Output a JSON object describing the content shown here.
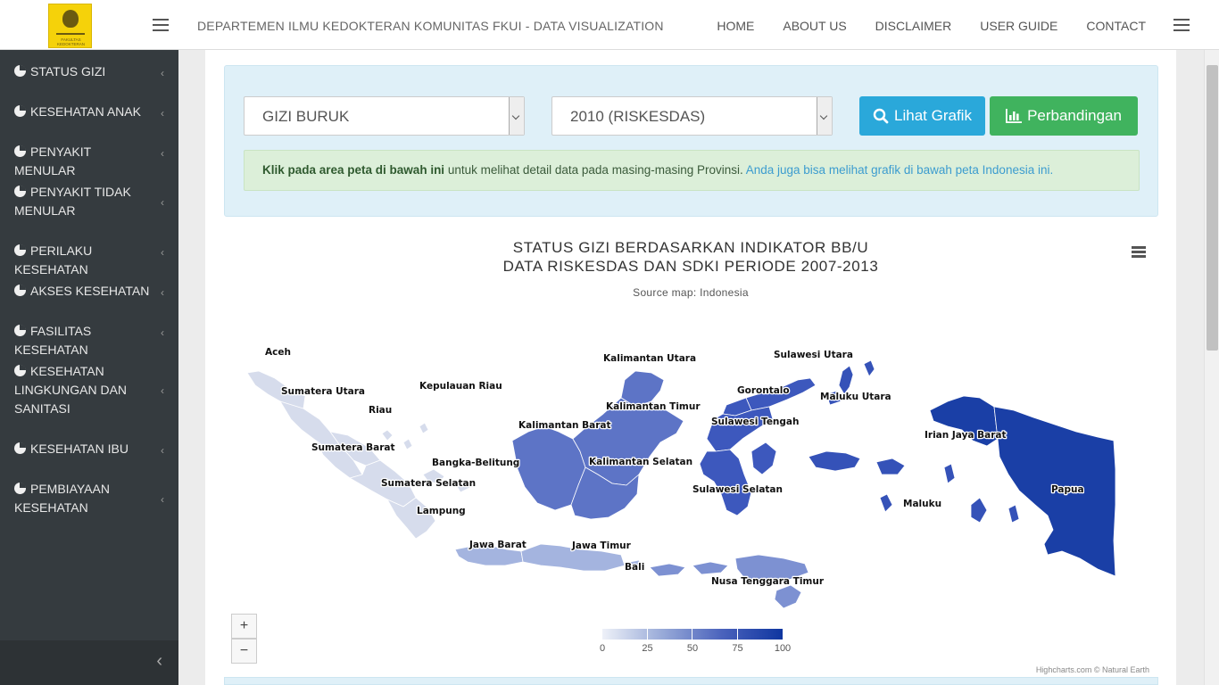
{
  "navbar": {
    "title": "DEPARTEMEN ILMU KEDOKTERAN KOMUNITAS FKUI - DATA VISUALIZATION",
    "menu": [
      "HOME",
      "ABOUT US",
      "DISCLAIMER",
      "USER GUIDE",
      "CONTACT"
    ],
    "logo_text": "FAKULTAS KEDOKTERAN"
  },
  "sidebar": {
    "items": [
      {
        "label": "STATUS GIZI"
      },
      {
        "label": "KESEHATAN ANAK"
      },
      {
        "label": "PENYAKIT MENULAR"
      },
      {
        "label": "PENYAKIT TIDAK MENULAR"
      },
      {
        "label": "PERILAKU KESEHATAN"
      },
      {
        "label": "AKSES KESEHATAN"
      },
      {
        "label": "FASILITAS KESEHATAN"
      },
      {
        "label": "KESEHATAN LINGKUNGAN DAN SANITASI"
      },
      {
        "label": "KESEHATAN IBU"
      },
      {
        "label": "PEMBIAYAAN KESEHATAN"
      }
    ]
  },
  "filters": {
    "indicator": "GIZI BURUK",
    "period": "2010 (RISKESDAS)",
    "view_button": "Lihat Grafik",
    "compare_button": "Perbandingan"
  },
  "notice": {
    "bold": "Klik pada area peta di bawah ini",
    "text": " untuk melihat detail data pada masing-masing Provinsi. ",
    "link": "Anda juga bisa melihat grafik di bawah peta Indonesia ini."
  },
  "chart": {
    "title_line1": "STATUS GIZI BERDASARKAN INDIKATOR BB/U",
    "title_line2": "DATA RISKESDAS DAN SDKI PERIODE 2007-2013",
    "subtitle": "Source map: Indonesia",
    "credits": "Highcharts.com © Natural Earth",
    "zoom_in": "+",
    "zoom_out": "−"
  },
  "colors": {
    "sidebar_bg": "#353b3f",
    "accent_info": "#2aa8da",
    "accent_success": "#40b35e",
    "map_low": "#d2d9ec",
    "map_high": "#0f36a0"
  },
  "chart_data": {
    "type": "choropleth-map",
    "legend": {
      "min": 0,
      "max": 100,
      "ticks": [
        "0",
        "25",
        "50",
        "75",
        "100"
      ]
    },
    "regions": [
      {
        "name": "Aceh",
        "color": "#d6dcec"
      },
      {
        "name": "Sumatera Utara",
        "color": "#d6dcec"
      },
      {
        "name": "Riau",
        "color": "#d6dcec"
      },
      {
        "name": "Kepulauan Riau",
        "color": "#d6dcec"
      },
      {
        "name": "Sumatera Barat",
        "color": "#d6dcec"
      },
      {
        "name": "Bangka-Belitung",
        "color": "#d6dcec"
      },
      {
        "name": "Sumatera Selatan",
        "color": "#d6dcec"
      },
      {
        "name": "Lampung",
        "color": "#d6dcec"
      },
      {
        "name": "Kalimantan Utara",
        "color": "#5d74c6"
      },
      {
        "name": "Kalimantan Barat",
        "color": "#5d74c6"
      },
      {
        "name": "Kalimantan Timur",
        "color": "#5d74c6"
      },
      {
        "name": "Kalimantan Selatan",
        "color": "#5d74c6"
      },
      {
        "name": "Jawa Barat",
        "color": "#a4b4df"
      },
      {
        "name": "Jawa Timur",
        "color": "#a4b4df"
      },
      {
        "name": "Bali",
        "color": "#a4b4df"
      },
      {
        "name": "Nusa Tenggara Timur",
        "color": "#7d91d2"
      },
      {
        "name": "Sulawesi Utara",
        "color": "#3d58bd"
      },
      {
        "name": "Gorontalo",
        "color": "#3d58bd"
      },
      {
        "name": "Sulawesi Tengah",
        "color": "#3d58bd"
      },
      {
        "name": "Sulawesi Selatan",
        "color": "#3d58bd"
      },
      {
        "name": "Maluku Utara",
        "color": "#3552b8"
      },
      {
        "name": "Maluku",
        "color": "#3552b8"
      },
      {
        "name": "Irian Jaya Barat",
        "color": "#1a3fa6"
      },
      {
        "name": "Papua",
        "color": "#1a3fa6"
      }
    ]
  }
}
